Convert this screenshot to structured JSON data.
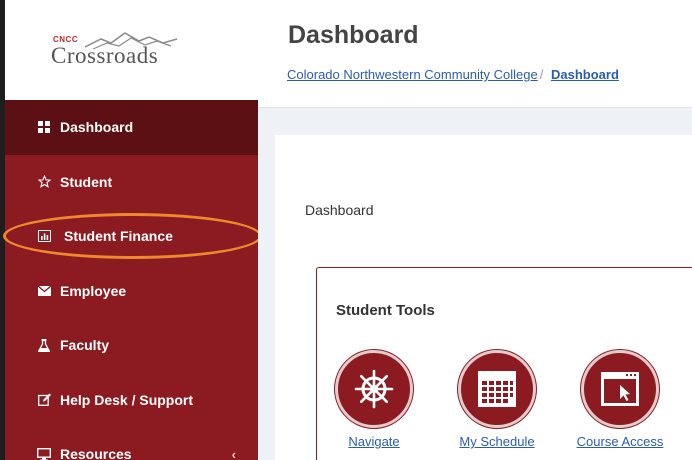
{
  "logo": {
    "small": "CNCC",
    "main": "Crossroads"
  },
  "sidebar": {
    "items": [
      {
        "label": "Dashboard",
        "icon": "dashboard-icon"
      },
      {
        "label": "Student",
        "icon": "star-icon"
      },
      {
        "label": "Student Finance",
        "icon": "chart-icon"
      },
      {
        "label": "Employee",
        "icon": "envelope-icon"
      },
      {
        "label": "Faculty",
        "icon": "flask-icon"
      },
      {
        "label": "Help Desk / Support",
        "icon": "edit-icon"
      },
      {
        "label": "Resources",
        "icon": "monitor-icon"
      }
    ],
    "resources_chevron": "‹"
  },
  "header": {
    "title": "Dashboard",
    "breadcrumb": {
      "home": "Colorado Northwestern Community College",
      "separator": "/",
      "current": "Dashboard"
    }
  },
  "main": {
    "panel_label": "Dashboard",
    "tools": {
      "title": "Student Tools",
      "items": [
        {
          "label": "Navigate",
          "icon": "ships-wheel-icon"
        },
        {
          "label": "My Schedule",
          "icon": "calendar-icon"
        },
        {
          "label": "Course Access",
          "icon": "browser-cursor-icon"
        }
      ]
    }
  },
  "colors": {
    "brand": "#8b1b20",
    "brand_dark": "#5d1013",
    "link": "#2a5db0",
    "highlight": "#f0882d",
    "background": "#eef1f6"
  }
}
